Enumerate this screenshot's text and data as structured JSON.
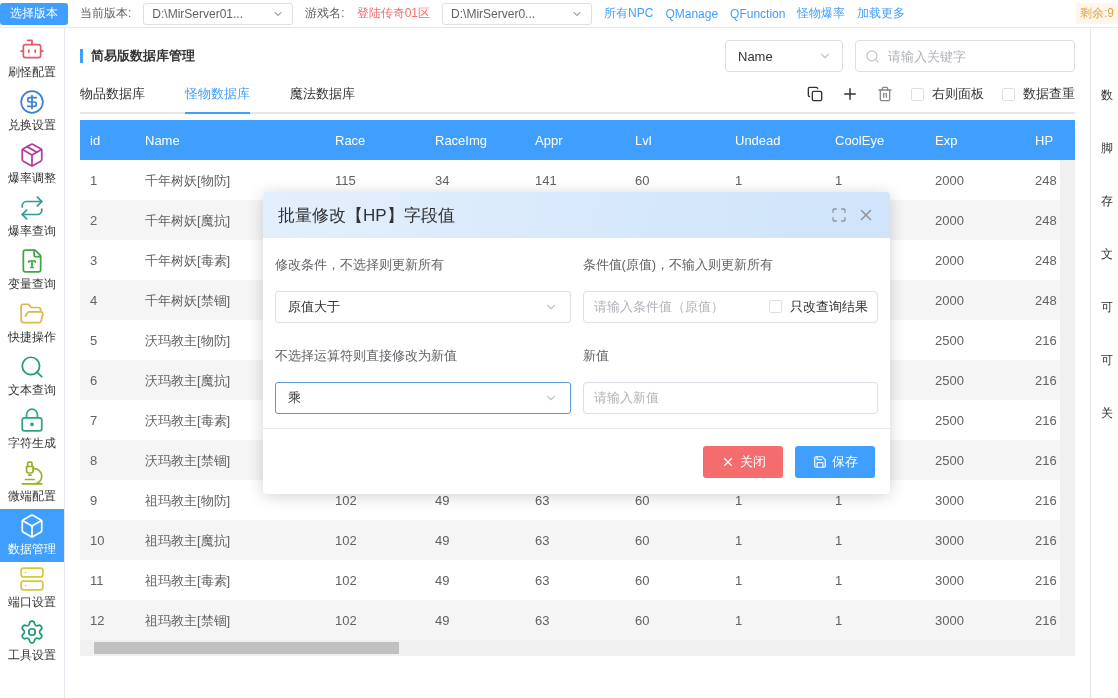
{
  "top_bar": {
    "version_button": "选择版本",
    "version_label": "当前版本:",
    "version_path": "D:\\MirServer01...",
    "game_label": "游戏名:",
    "game_name": "登陆传奇01区",
    "server_path": "D:\\MirServer0...",
    "links": [
      "所有NPC",
      "QManage",
      "QFunction",
      "怪物爆率",
      "加载更多"
    ],
    "remaining": "剩余:9"
  },
  "sidebar": {
    "items": [
      {
        "label": "刷怪配置",
        "selected": false
      },
      {
        "label": "兑换设置",
        "selected": false
      },
      {
        "label": "爆率调整",
        "selected": false
      },
      {
        "label": "爆率查询",
        "selected": false
      },
      {
        "label": "变量查询",
        "selected": false
      },
      {
        "label": "快捷操作",
        "selected": false
      },
      {
        "label": "文本查询",
        "selected": false
      },
      {
        "label": "字符生成",
        "selected": false
      },
      {
        "label": "微端配置",
        "selected": false
      },
      {
        "label": "数据管理",
        "selected": true
      },
      {
        "label": "端口设置",
        "selected": false
      },
      {
        "label": "工具设置",
        "selected": false
      }
    ]
  },
  "page": {
    "title": "简易版数据库管理",
    "field_select": "Name",
    "search": {
      "placeholder": "请输入关键字"
    }
  },
  "tabs": [
    {
      "label": "物品数据库",
      "selected": false
    },
    {
      "label": "怪物数据库",
      "selected": true
    },
    {
      "label": "魔法数据库",
      "selected": false
    }
  ],
  "options": [
    {
      "label": "右则面板",
      "checked": false
    },
    {
      "label": "数据查重",
      "checked": false
    }
  ],
  "table": {
    "columns": [
      "id",
      "Name",
      "Race",
      "RaceImg",
      "Appr",
      "Lvl",
      "Undead",
      "CoolEye",
      "Exp",
      "HP"
    ],
    "rows": [
      [
        "1",
        "千年树妖[物防]",
        "115",
        "34",
        "141",
        "60",
        "1",
        "1",
        "2000",
        "248"
      ],
      [
        "2",
        "千年树妖[魔抗]",
        null,
        null,
        null,
        null,
        null,
        null,
        "2000",
        "248"
      ],
      [
        "3",
        "千年树妖[毒素]",
        null,
        null,
        null,
        null,
        null,
        null,
        "2000",
        "248"
      ],
      [
        "4",
        "千年树妖[禁锢]",
        null,
        null,
        null,
        null,
        null,
        null,
        "2000",
        "248"
      ],
      [
        "5",
        "沃玛教主[物防]",
        null,
        null,
        null,
        null,
        null,
        null,
        "2500",
        "216"
      ],
      [
        "6",
        "沃玛教主[魔抗]",
        null,
        null,
        null,
        null,
        null,
        null,
        "2500",
        "216"
      ],
      [
        "7",
        "沃玛教主[毒素]",
        null,
        null,
        null,
        null,
        null,
        null,
        "2500",
        "216"
      ],
      [
        "8",
        "沃玛教主[禁锢]",
        null,
        null,
        null,
        null,
        null,
        null,
        "2500",
        "216"
      ],
      [
        "9",
        "祖玛教主[物防]",
        "102",
        "49",
        "63",
        "60",
        "1",
        "1",
        "3000",
        "216"
      ],
      [
        "10",
        "祖玛教主[魔抗]",
        "102",
        "49",
        "63",
        "60",
        "1",
        "1",
        "3000",
        "216"
      ],
      [
        "11",
        "祖玛教主[毒素]",
        "102",
        "49",
        "63",
        "60",
        "1",
        "1",
        "3000",
        "216"
      ],
      [
        "12",
        "祖玛教主[禁锢]",
        "102",
        "49",
        "63",
        "60",
        "1",
        "1",
        "3000",
        "216"
      ]
    ]
  },
  "right_panel": {
    "items": [
      "数",
      "脚",
      "存",
      "文",
      "可",
      "可",
      "关"
    ]
  },
  "dialog": {
    "title": "批量修改【HP】字段值",
    "condition_label": "修改条件，不选择则更新所有",
    "condition_value": "原值大于",
    "condition_value_label": "条件值(原值)，不输入则更新所有",
    "condition_value_placeholder": "请输入条件值（原值）",
    "only_results": {
      "label": "只改查询结果",
      "checked": false
    },
    "operator_label": "不选择运算符则直接修改为新值",
    "operator_value": "乘",
    "new_value_label": "新值",
    "new_value_placeholder": "请输入新值",
    "buttons": [
      {
        "kind": "close",
        "label": "关闭"
      },
      {
        "kind": "save",
        "label": "保存"
      }
    ]
  }
}
